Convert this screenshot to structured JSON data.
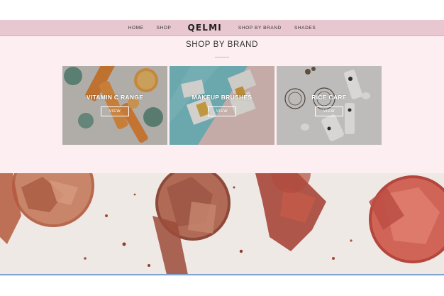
{
  "nav": {
    "links_left": [
      "HOME",
      "SHOP"
    ],
    "brand": "QELMI",
    "links_right": [
      "SHOP BY BRAND",
      "SHADES"
    ]
  },
  "section": {
    "title": "SHOP BY BRAND"
  },
  "cards": [
    {
      "label": "VITAMIN C RANGE",
      "button": "VIEW"
    },
    {
      "label": "MAKEUP BRUSHES",
      "button": "VIEW"
    },
    {
      "label": "RICE CARE",
      "button": "VIEW"
    }
  ],
  "colors": {
    "navbar": "#e8c7d1",
    "section_bg": "#fdeef2",
    "accent_rule": "#e2a7b4",
    "bottom_rule": "#7fa3cc"
  },
  "icons": [
    "vitamin-c-product-photo",
    "makeup-brushes-product-photo",
    "rice-care-product-photo",
    "crushed-powder-photo"
  ]
}
